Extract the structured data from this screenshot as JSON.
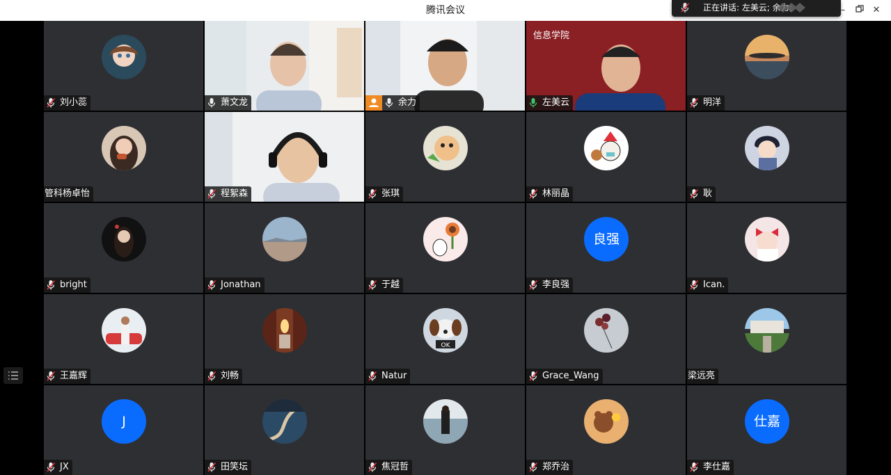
{
  "window": {
    "title": "腾讯会议"
  },
  "speaking": {
    "text": "正在讲话: 左美云; 余力;"
  },
  "accent": {
    "avatar_blue": "#0a6cff",
    "host_orange": "#f08a24",
    "mic_active": "#3dc46a"
  },
  "participants": [
    {
      "name": "刘小蕊",
      "mic": "muted",
      "kind": "photo",
      "icon": "anime-girl-avatar"
    },
    {
      "name": "萧文龙",
      "mic": "on",
      "kind": "video",
      "icon": "video-man-office"
    },
    {
      "name": "余力",
      "mic": "on",
      "kind": "video",
      "icon": "video-man-smiling",
      "host": true
    },
    {
      "name": "左美云",
      "mic": "active",
      "kind": "video",
      "icon": "video-man-red-background",
      "banner": "信息学院"
    },
    {
      "name": "明洋",
      "mic": "muted",
      "kind": "photo",
      "icon": "sunset-avatar"
    },
    {
      "name": "管科杨卓怡",
      "mic": "none",
      "kind": "photo",
      "icon": "girl-photo-avatar"
    },
    {
      "name": "程絮森",
      "mic": "muted",
      "kind": "video",
      "icon": "video-man-headphones"
    },
    {
      "name": "张琪",
      "mic": "muted",
      "kind": "photo",
      "icon": "cartoon-avatar"
    },
    {
      "name": "林丽晶",
      "mic": "muted",
      "kind": "photo",
      "icon": "christmas-cartoon-avatar"
    },
    {
      "name": "耿",
      "mic": "muted",
      "kind": "photo",
      "icon": "anime-boy-avatar"
    },
    {
      "name": "bright",
      "mic": "muted",
      "kind": "photo",
      "icon": "woman-dark-avatar"
    },
    {
      "name": "Jonathan",
      "mic": "muted",
      "kind": "photo",
      "icon": "landscape-avatar"
    },
    {
      "name": "于越",
      "mic": "muted",
      "kind": "photo",
      "icon": "flower-cartoon-avatar"
    },
    {
      "name": "李良强",
      "mic": "muted",
      "kind": "text",
      "initials": "良强"
    },
    {
      "name": "Ican.",
      "mic": "muted",
      "kind": "photo",
      "icon": "girl-red-bow-avatar"
    },
    {
      "name": "王嘉辉",
      "mic": "muted",
      "kind": "photo",
      "icon": "man-car-avatar"
    },
    {
      "name": "刘畅",
      "mic": "muted",
      "kind": "photo",
      "icon": "candle-avatar"
    },
    {
      "name": "Natur",
      "mic": "muted",
      "kind": "photo",
      "icon": "puppy-avatar",
      "avatar_text": "OK"
    },
    {
      "name": "Grace_Wang",
      "mic": "muted",
      "kind": "photo",
      "icon": "balloons-avatar"
    },
    {
      "name": "梁远亮",
      "mic": "none",
      "kind": "photo",
      "icon": "building-avatar"
    },
    {
      "name": "JX",
      "mic": "muted",
      "kind": "text",
      "initials": "J"
    },
    {
      "name": "田笑坛",
      "mic": "muted",
      "kind": "photo",
      "icon": "road-avatar"
    },
    {
      "name": "焦冠哲",
      "mic": "muted",
      "kind": "photo",
      "icon": "woman-seaside-avatar"
    },
    {
      "name": "郑乔治",
      "mic": "muted",
      "kind": "photo",
      "icon": "cartoon-bear-avatar"
    },
    {
      "name": "李仕嘉",
      "mic": "muted",
      "kind": "text",
      "initials": "仕嘉"
    }
  ]
}
